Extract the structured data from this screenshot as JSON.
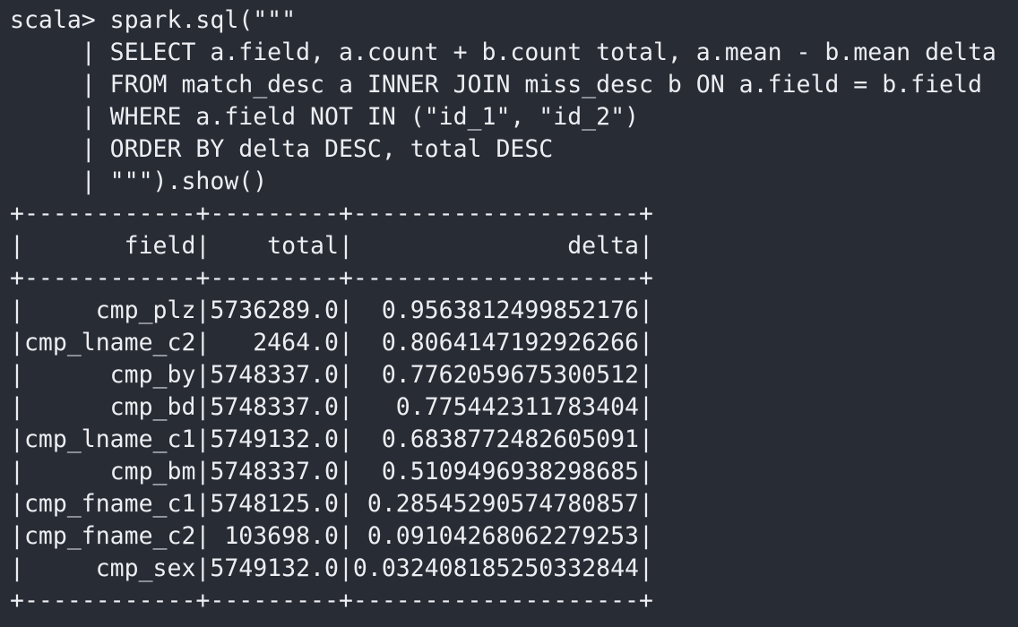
{
  "terminal": {
    "background_color": "#282c35",
    "text_color": "#eceef2",
    "prompt": "scala> ",
    "command_lines": [
      "scala> spark.sql(\"\"\"",
      "     | SELECT a.field, a.count + b.count total, a.mean - b.mean delta",
      "     | FROM match_desc a INNER JOIN miss_desc b ON a.field = b.field",
      "     | WHERE a.field NOT IN (\"id_1\", \"id_2\")",
      "     | ORDER BY delta DESC, total DESC",
      "     | \"\"\").show()"
    ],
    "result_table": {
      "border_line": "+------------+---------+--------------------+",
      "header_line": "|       field|    total|               delta|",
      "columns": [
        "field",
        "total",
        "delta"
      ],
      "rows": [
        [
          "cmp_plz",
          "5736289.0",
          "0.9563812499852176"
        ],
        [
          "cmp_lname_c2",
          "2464.0",
          "0.8064147192926266"
        ],
        [
          "cmp_by",
          "5748337.0",
          "0.7762059675300512"
        ],
        [
          "cmp_bd",
          "5748337.0",
          "0.775442311783404"
        ],
        [
          "cmp_lname_c1",
          "5749132.0",
          "0.6838772482605091"
        ],
        [
          "cmp_bm",
          "5748337.0",
          "0.5109496938298685"
        ],
        [
          "cmp_fname_c1",
          "5748125.0",
          "0.28545290574780857"
        ],
        [
          "cmp_fname_c2",
          "103698.0",
          "0.09104268062279253"
        ],
        [
          "cmp_sex",
          "5749132.0",
          "0.032408185250332844"
        ]
      ],
      "row_lines": [
        "|     cmp_plz|5736289.0|  0.9563812499852176|",
        "|cmp_lname_c2|   2464.0|  0.8064147192926266|",
        "|      cmp_by|5748337.0|  0.7762059675300512|",
        "|      cmp_bd|5748337.0|   0.775442311783404|",
        "|cmp_lname_c1|5749132.0|  0.6838772482605091|",
        "|      cmp_bm|5748337.0|  0.5109496938298685|",
        "|cmp_fname_c1|5748125.0| 0.28545290574780857|",
        "|cmp_fname_c2| 103698.0| 0.09104268062279253|",
        "|     cmp_sex|5749132.0|0.032408185250332844|"
      ]
    }
  }
}
